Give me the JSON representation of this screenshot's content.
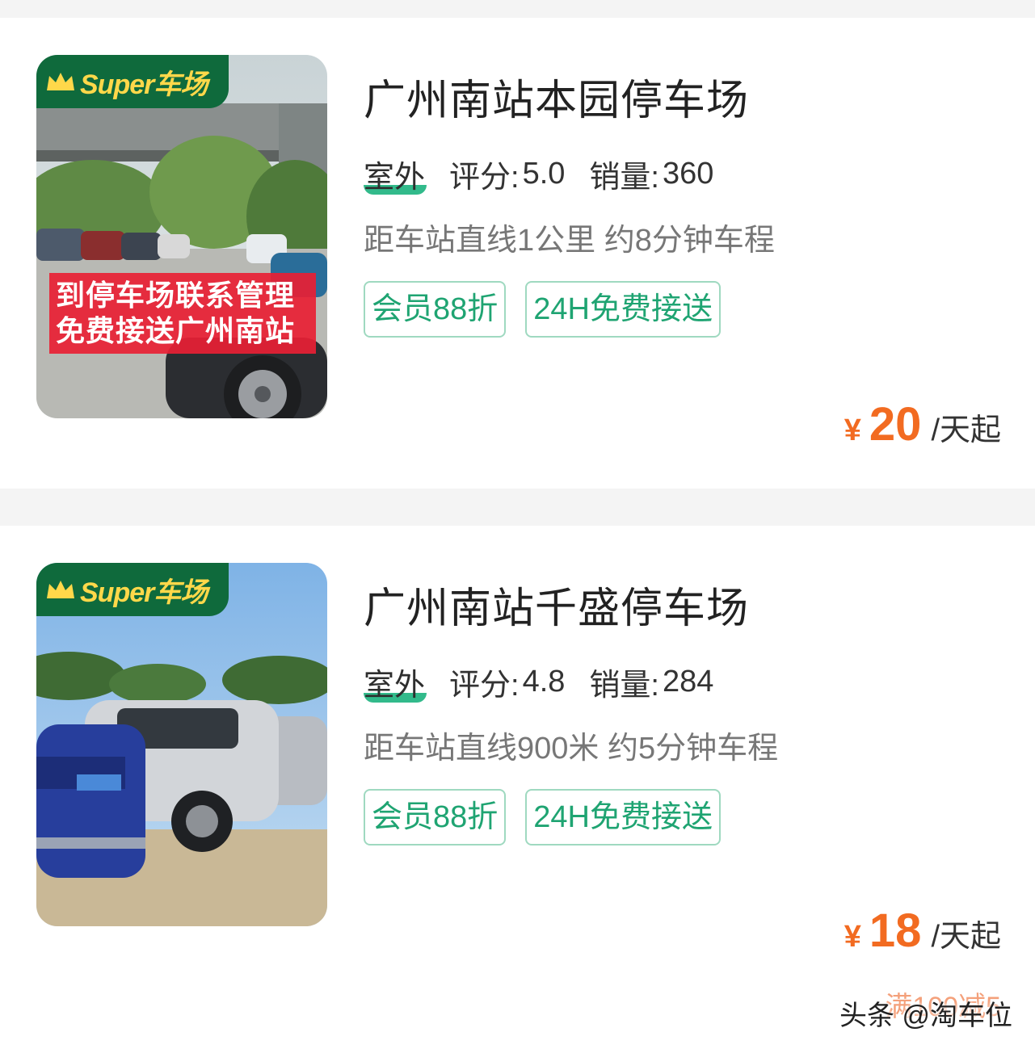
{
  "listings": [
    {
      "badge": "Super车场",
      "promo_lines": [
        "到停车场联系管理",
        "免费接送广州南站"
      ],
      "title": "广州南站本园停车场",
      "type": "室外",
      "rating_label": "评分:",
      "rating": "5.0",
      "sales_label": "销量:",
      "sales": "360",
      "distance": "距车站直线1公里 约8分钟车程",
      "tags": [
        "会员88折",
        "24H免费接送"
      ],
      "currency": "¥",
      "price": "20",
      "price_unit": "/天起"
    },
    {
      "badge": "Super车场",
      "title": "广州南站千盛停车场",
      "type": "室外",
      "rating_label": "评分:",
      "rating": "4.8",
      "sales_label": "销量:",
      "sales": "284",
      "distance": "距车站直线900米 约5分钟车程",
      "tags": [
        "会员88折",
        "24H免费接送"
      ],
      "currency": "¥",
      "price": "18",
      "price_unit": "/天起",
      "coupon": "满100减5"
    }
  ],
  "watermark": "头条 @淘车位",
  "colors": {
    "accent_green": "#1fa472",
    "badge_green": "#0f6a3c",
    "price_orange": "#f26b21",
    "promo_red": "#e82034"
  }
}
